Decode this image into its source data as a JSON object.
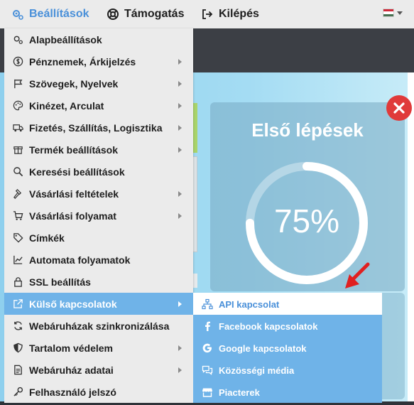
{
  "topbar": {
    "settings_label": "Beállítások",
    "support_label": "Támogatás",
    "logout_label": "Kilépés",
    "language_flag": "hungarian-flag-icon",
    "flag_colors": [
      "#ce2939",
      "#ffffff",
      "#477050"
    ]
  },
  "menu": {
    "items": [
      {
        "label": "Alapbeállítások",
        "icon": "gear-cog-icon"
      },
      {
        "label": "Pénznemek, Árkijelzés",
        "icon": "coin-icon"
      },
      {
        "label": "Szövegek, Nyelvek",
        "icon": "flag-icon"
      },
      {
        "label": "Kinézet, Arculat",
        "icon": "palette-icon"
      },
      {
        "label": "Fizetés, Szállítás, Logisztika",
        "icon": "truck-icon"
      },
      {
        "label": "Termék beállítások",
        "icon": "box-icon"
      },
      {
        "label": "Keresési beállítások",
        "icon": "search-icon"
      },
      {
        "label": "Vásárlási feltételek",
        "icon": "gavel-icon"
      },
      {
        "label": "Vásárlási folyamat",
        "icon": "cart-icon"
      },
      {
        "label": "Címkék",
        "icon": "tag-icon"
      },
      {
        "label": "Automata folyamatok",
        "icon": "chart-icon"
      },
      {
        "label": "SSL beállítás",
        "icon": "lock-icon"
      },
      {
        "label": "Külső kapcsolatok",
        "icon": "external-link-icon"
      },
      {
        "label": "Webáruházak szinkronizálása",
        "icon": "sync-icon"
      },
      {
        "label": "Tartalom védelem",
        "icon": "shield-icon"
      },
      {
        "label": "Webáruház adatai",
        "icon": "document-icon"
      },
      {
        "label": "Felhasználó jelszó",
        "icon": "key-icon"
      }
    ]
  },
  "submenu": {
    "items": [
      {
        "label": "API kapcsolat",
        "icon": "network-icon"
      },
      {
        "label": "Facebook kapcsolatok",
        "icon": "facebook-icon"
      },
      {
        "label": "Google kapcsolatok",
        "icon": "google-icon"
      },
      {
        "label": "Közösségi média",
        "icon": "comments-icon"
      },
      {
        "label": "Piacterek",
        "icon": "store-icon"
      }
    ]
  },
  "card": {
    "title": "Első lépések",
    "progress_text": "75%",
    "progress_fraction": 0.75
  },
  "colors": {
    "accent": "#6fb3e8",
    "active_text": "#4a90d9",
    "close": "#e03a3a",
    "arrow": "#e02020"
  }
}
